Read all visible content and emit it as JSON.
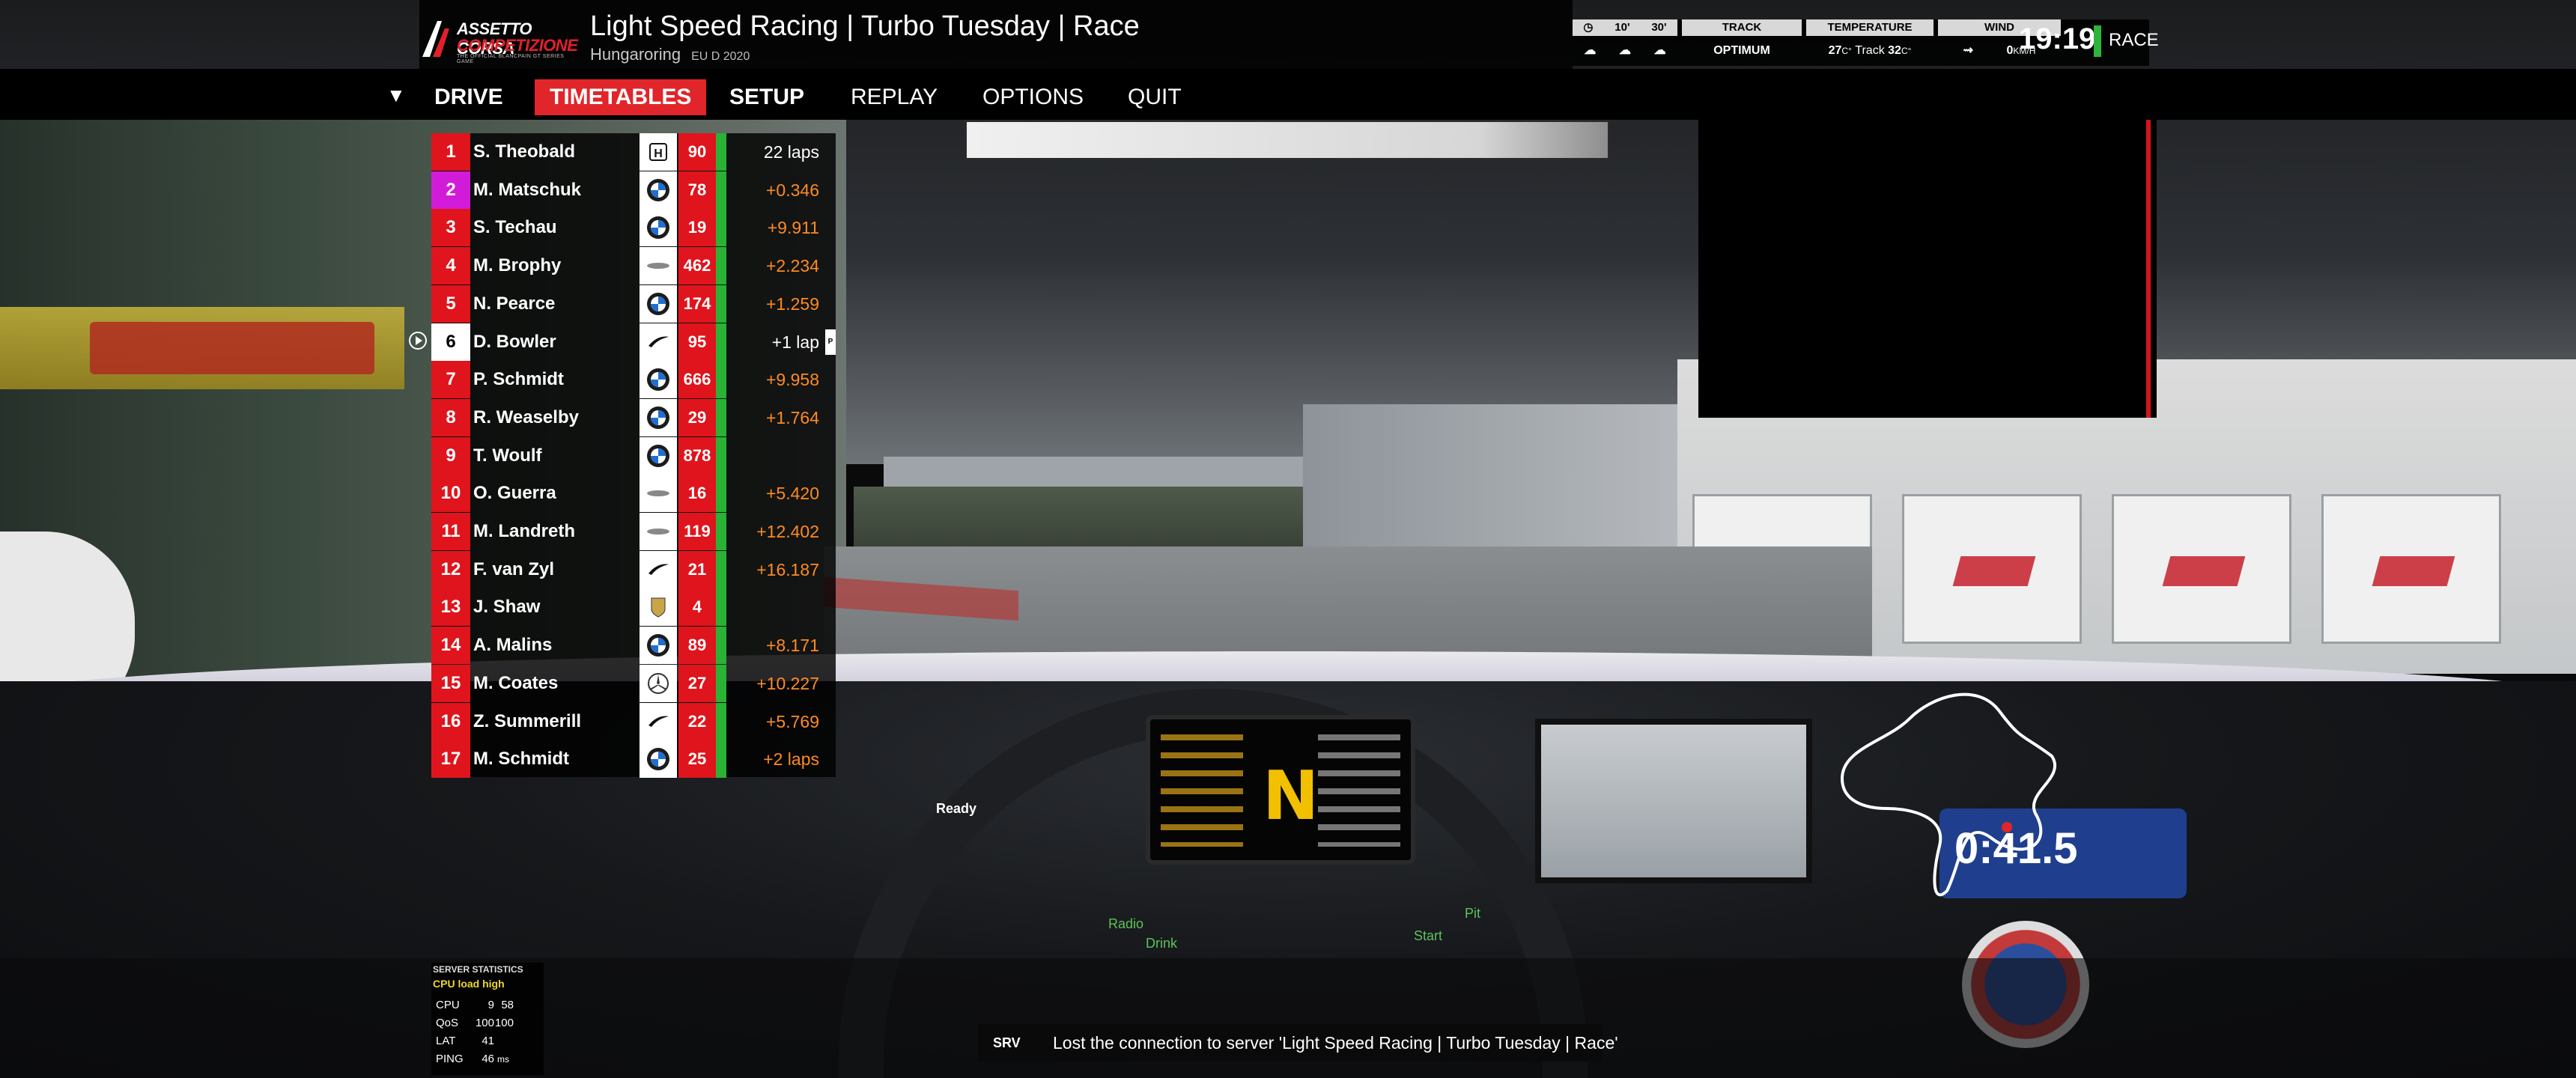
{
  "header": {
    "logo": {
      "line1": "ASSETTO CORSA",
      "line2": "COMPETIZIONE",
      "line3": "THE OFFICIAL BLANCPAIN GT SERIES GAME"
    },
    "session_title": "Light Speed Racing | Turbo Tuesday | Race",
    "track": "Hungaroring",
    "version": "EU D 2020"
  },
  "weather": {
    "time_now": "10'",
    "time_later": "30'",
    "track_label": "TRACK",
    "track_state": "OPTIMUM",
    "temperature_label": "TEMPERATURE",
    "air_temp": "27",
    "track_temp_label": "Track",
    "track_temp": "32",
    "temp_unit": "C°",
    "wind_label": "WIND",
    "wind_speed": "0",
    "wind_unit": "KM/H"
  },
  "clock": {
    "time": "19:19",
    "session": "RACE",
    "status_color": "#2db43a"
  },
  "menu": {
    "items": [
      {
        "label": "DRIVE"
      },
      {
        "label": "TIMETABLES"
      },
      {
        "label": "SETUP"
      },
      {
        "label": "REPLAY"
      },
      {
        "label": "OPTIONS"
      },
      {
        "label": "QUIT"
      }
    ],
    "active": "TIMETABLES"
  },
  "standings": [
    {
      "pos": "1",
      "name": "S. Theobald",
      "brand": "honda",
      "car": "90",
      "gap": "22 laps"
    },
    {
      "pos": "2",
      "name": "M. Matschuk",
      "brand": "bmw",
      "car": "78",
      "gap": "+0.346"
    },
    {
      "pos": "3",
      "name": "S. Techau",
      "brand": "bmw",
      "car": "19",
      "gap": "+9.911"
    },
    {
      "pos": "4",
      "name": "M. Brophy",
      "brand": "lexus",
      "car": "462",
      "gap": "+2.234"
    },
    {
      "pos": "5",
      "name": "N. Pearce",
      "brand": "bmw",
      "car": "174",
      "gap": "+1.259"
    },
    {
      "pos": "6",
      "name": "D. Bowler",
      "brand": "mclaren",
      "car": "95",
      "gap": "+1 lap",
      "pit": "P"
    },
    {
      "pos": "7",
      "name": "P. Schmidt",
      "brand": "bmw",
      "car": "666",
      "gap": "+9.958"
    },
    {
      "pos": "8",
      "name": "R. Weaselby",
      "brand": "bmw",
      "car": "29",
      "gap": "+1.764"
    },
    {
      "pos": "9",
      "name": "T. Woulf",
      "brand": "bmw",
      "car": "878",
      "gap": ""
    },
    {
      "pos": "10",
      "name": "O. Guerra",
      "brand": "lexus",
      "car": "16",
      "gap": "+5.420"
    },
    {
      "pos": "11",
      "name": "M. Landreth",
      "brand": "lexus",
      "car": "119",
      "gap": "+12.402"
    },
    {
      "pos": "12",
      "name": "F. van Zyl",
      "brand": "mclaren",
      "car": "21",
      "gap": "+16.187"
    },
    {
      "pos": "13",
      "name": "J. Shaw",
      "brand": "porsche",
      "car": "4",
      "gap": ""
    },
    {
      "pos": "14",
      "name": "A. Malins",
      "brand": "bmw",
      "car": "89",
      "gap": "+8.171"
    },
    {
      "pos": "15",
      "name": "M. Coates",
      "brand": "mercedes",
      "car": "27",
      "gap": "+10.227"
    },
    {
      "pos": "16",
      "name": "Z. Summerill",
      "brand": "mclaren",
      "car": "22",
      "gap": "+5.769"
    },
    {
      "pos": "17",
      "name": "M. Schmidt",
      "brand": "bmw",
      "car": "25",
      "gap": "+2 laps"
    }
  ],
  "server_stats": {
    "title": "SERVER STATISTICS",
    "warning": "CPU load high",
    "rows": [
      {
        "label": "CPU",
        "a": "9",
        "b": "58"
      },
      {
        "label": "QoS",
        "a": "100",
        "b": "100"
      },
      {
        "label": "LAT",
        "a": "41",
        "b": ""
      },
      {
        "label": "PING",
        "a": "46",
        "b": "ms"
      }
    ]
  },
  "hud": {
    "ready": "Ready",
    "radio": "Radio",
    "drink": "Drink",
    "start": "Start",
    "pit": "Pit",
    "gear": "N",
    "timer": "0:41.5"
  },
  "notification": {
    "tag": "SRV",
    "message": "Lost the connection to server 'Light Speed Racing | Turbo Tuesday | Race'"
  },
  "colors": {
    "accent_red": "#e0262a",
    "leader_purple": "#d21bd9",
    "gap_orange": "#ff8a22",
    "status_green": "#29b234"
  }
}
